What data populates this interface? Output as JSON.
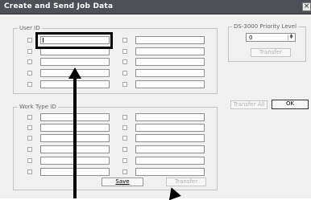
{
  "window": {
    "title": "Create and Send Job Data",
    "close_glyph": "×"
  },
  "user_id": {
    "legend": "User ID",
    "rows": 6
  },
  "work_type_id": {
    "legend": "Work Type ID",
    "rows": 6
  },
  "priority": {
    "legend": "DS-3000 Priority Level",
    "value": "0",
    "transfer_label": "Transfer"
  },
  "actions": {
    "transfer_all_label": "Transfer All",
    "ok_label": "OK"
  },
  "bottom": {
    "save_label": "Save",
    "transfer_label": "Transfer"
  }
}
